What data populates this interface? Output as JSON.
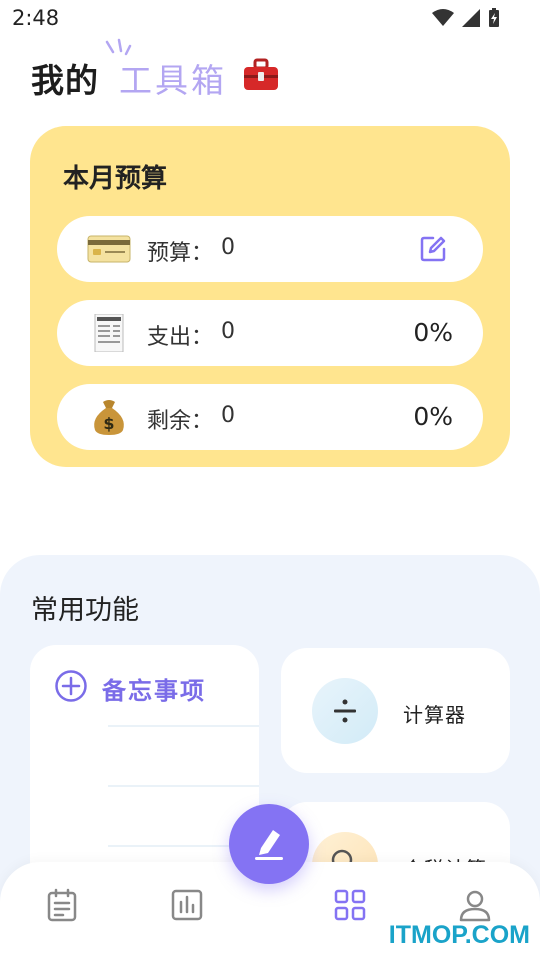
{
  "status_bar": {
    "time": "2:48"
  },
  "header": {
    "title": "我的",
    "accent": "工具箱"
  },
  "budget": {
    "title": "本月预算",
    "rows": [
      {
        "label": "预算：",
        "value": "0",
        "icon": "credit-card-icon"
      },
      {
        "label": "支出：",
        "value": "0",
        "percent": "0%",
        "icon": "receipt-icon"
      },
      {
        "label": "剩余：",
        "value": "0",
        "percent": "0%",
        "icon": "money-bag-icon"
      }
    ]
  },
  "common": {
    "title": "常用功能",
    "memo_label": "备忘事项",
    "tools": [
      {
        "label": "计算器",
        "icon": "divide-icon"
      },
      {
        "label": "个税计算",
        "icon": "search-icon"
      }
    ]
  },
  "nav": {
    "items": [
      "calendar-icon",
      "chart-icon",
      "grid-icon",
      "user-icon"
    ]
  },
  "watermark": "ITMOP.COM",
  "colors": {
    "budget_card": "#ffe58f",
    "accent_purple": "#8473f3",
    "panel_bg": "#eff4fc",
    "header_accent": "#b3a6f2",
    "nav_active": "#8473f3",
    "nav_inactive": "#888888"
  }
}
